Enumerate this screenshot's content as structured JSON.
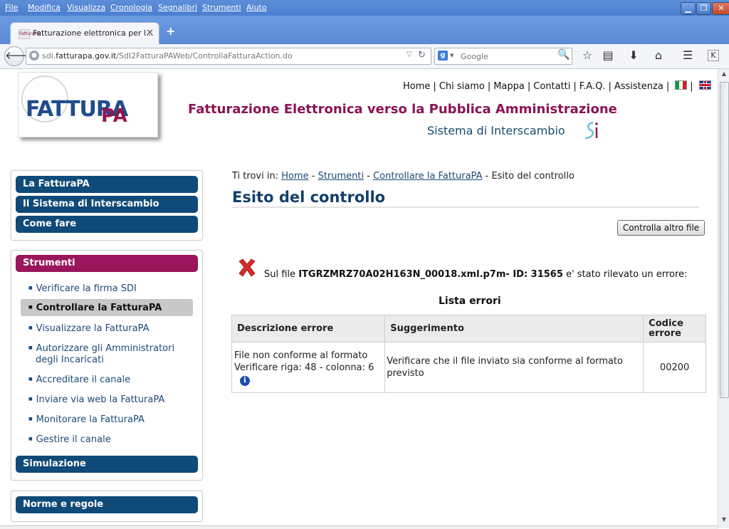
{
  "browser": {
    "menu": [
      "File",
      "Modifica",
      "Visualizza",
      "Cronologia",
      "Segnalibri",
      "Strumenti",
      "Aiuto"
    ],
    "tab_title": "Fatturazione elettronica per l...",
    "favicon_text": "FatturaPA",
    "url_domain_pre": "sdi.",
    "url_domain": "fatturapa.gov.it",
    "url_path": "/SdI2FatturaPAWeb/ControllaFatturaAction.do",
    "search_placeholder": "Google",
    "search_engine_icon": "g-icon"
  },
  "header": {
    "logo_main": "FATTURA",
    "logo_pa": "PA",
    "links": [
      "Home",
      "Chi siamo",
      "Mappa",
      "Contatti",
      "F.A.Q.",
      "Assistenza"
    ],
    "title": "Fatturazione Elettronica verso la Pubblica Amministrazione",
    "subtitle": "Sistema di Interscambio",
    "sdi_logo": "Sdi"
  },
  "sidebar": {
    "panel1": [
      "La FatturaPA",
      "Il Sistema di Interscambio",
      "Come fare"
    ],
    "strumenti_title": "Strumenti",
    "strumenti_links": [
      "Verificare la firma SDI",
      "Controllare la FatturaPA",
      "Visualizzare la FatturaPA",
      "Autorizzare gli Amministratori",
      "degli Incaricati",
      "Accreditare il canale",
      "Inviare via web la FatturaPA",
      "Monitorare la FatturaPA",
      "Gestire il canale"
    ],
    "simulazione": "Simulazione",
    "norme": "Norme e regole"
  },
  "main": {
    "breadcrumb_prefix": "Ti trovi in:",
    "breadcrumb": [
      "Home",
      "Strumenti",
      "Controllare la FatturaPA",
      "Esito del controllo"
    ],
    "heading": "Esito del controllo",
    "button_label": "Controlla altro file",
    "error_prefix": "Sul file",
    "error_file": "ITGRZMRZ70A02H163N_00018.xml.p7m- ID: 31565",
    "error_suffix": "e' stato rilevato un errore:",
    "lista_title": "Lista errori",
    "table_headers": [
      "Descrizione errore",
      "Suggerimento",
      "Codice errore"
    ],
    "table_rows": [
      {
        "descrizione": "File non conforme al formato Verificare riga: 48 - colonna: 6",
        "suggerimento": "Verificare che il file inviato sia conforme al formato previsto",
        "codice": "00200"
      }
    ]
  },
  "colors": {
    "nav_blue": "#0f4a78",
    "nav_purple": "#9a155b",
    "title_purple": "#8c1353",
    "error_red": "#d42a2a"
  }
}
